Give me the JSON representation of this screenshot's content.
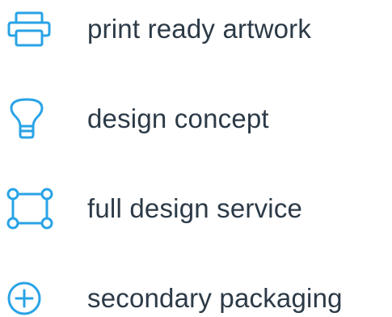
{
  "accent_color": "#29a3e6",
  "text_color": "#2c3a47",
  "items": [
    {
      "label": "print ready artwork",
      "icon": "printer-icon"
    },
    {
      "label": "design concept",
      "icon": "lightbulb-icon"
    },
    {
      "label": "full design service",
      "icon": "vector-nodes-icon"
    },
    {
      "label": "secondary packaging",
      "icon": "plus-circle-icon"
    }
  ]
}
